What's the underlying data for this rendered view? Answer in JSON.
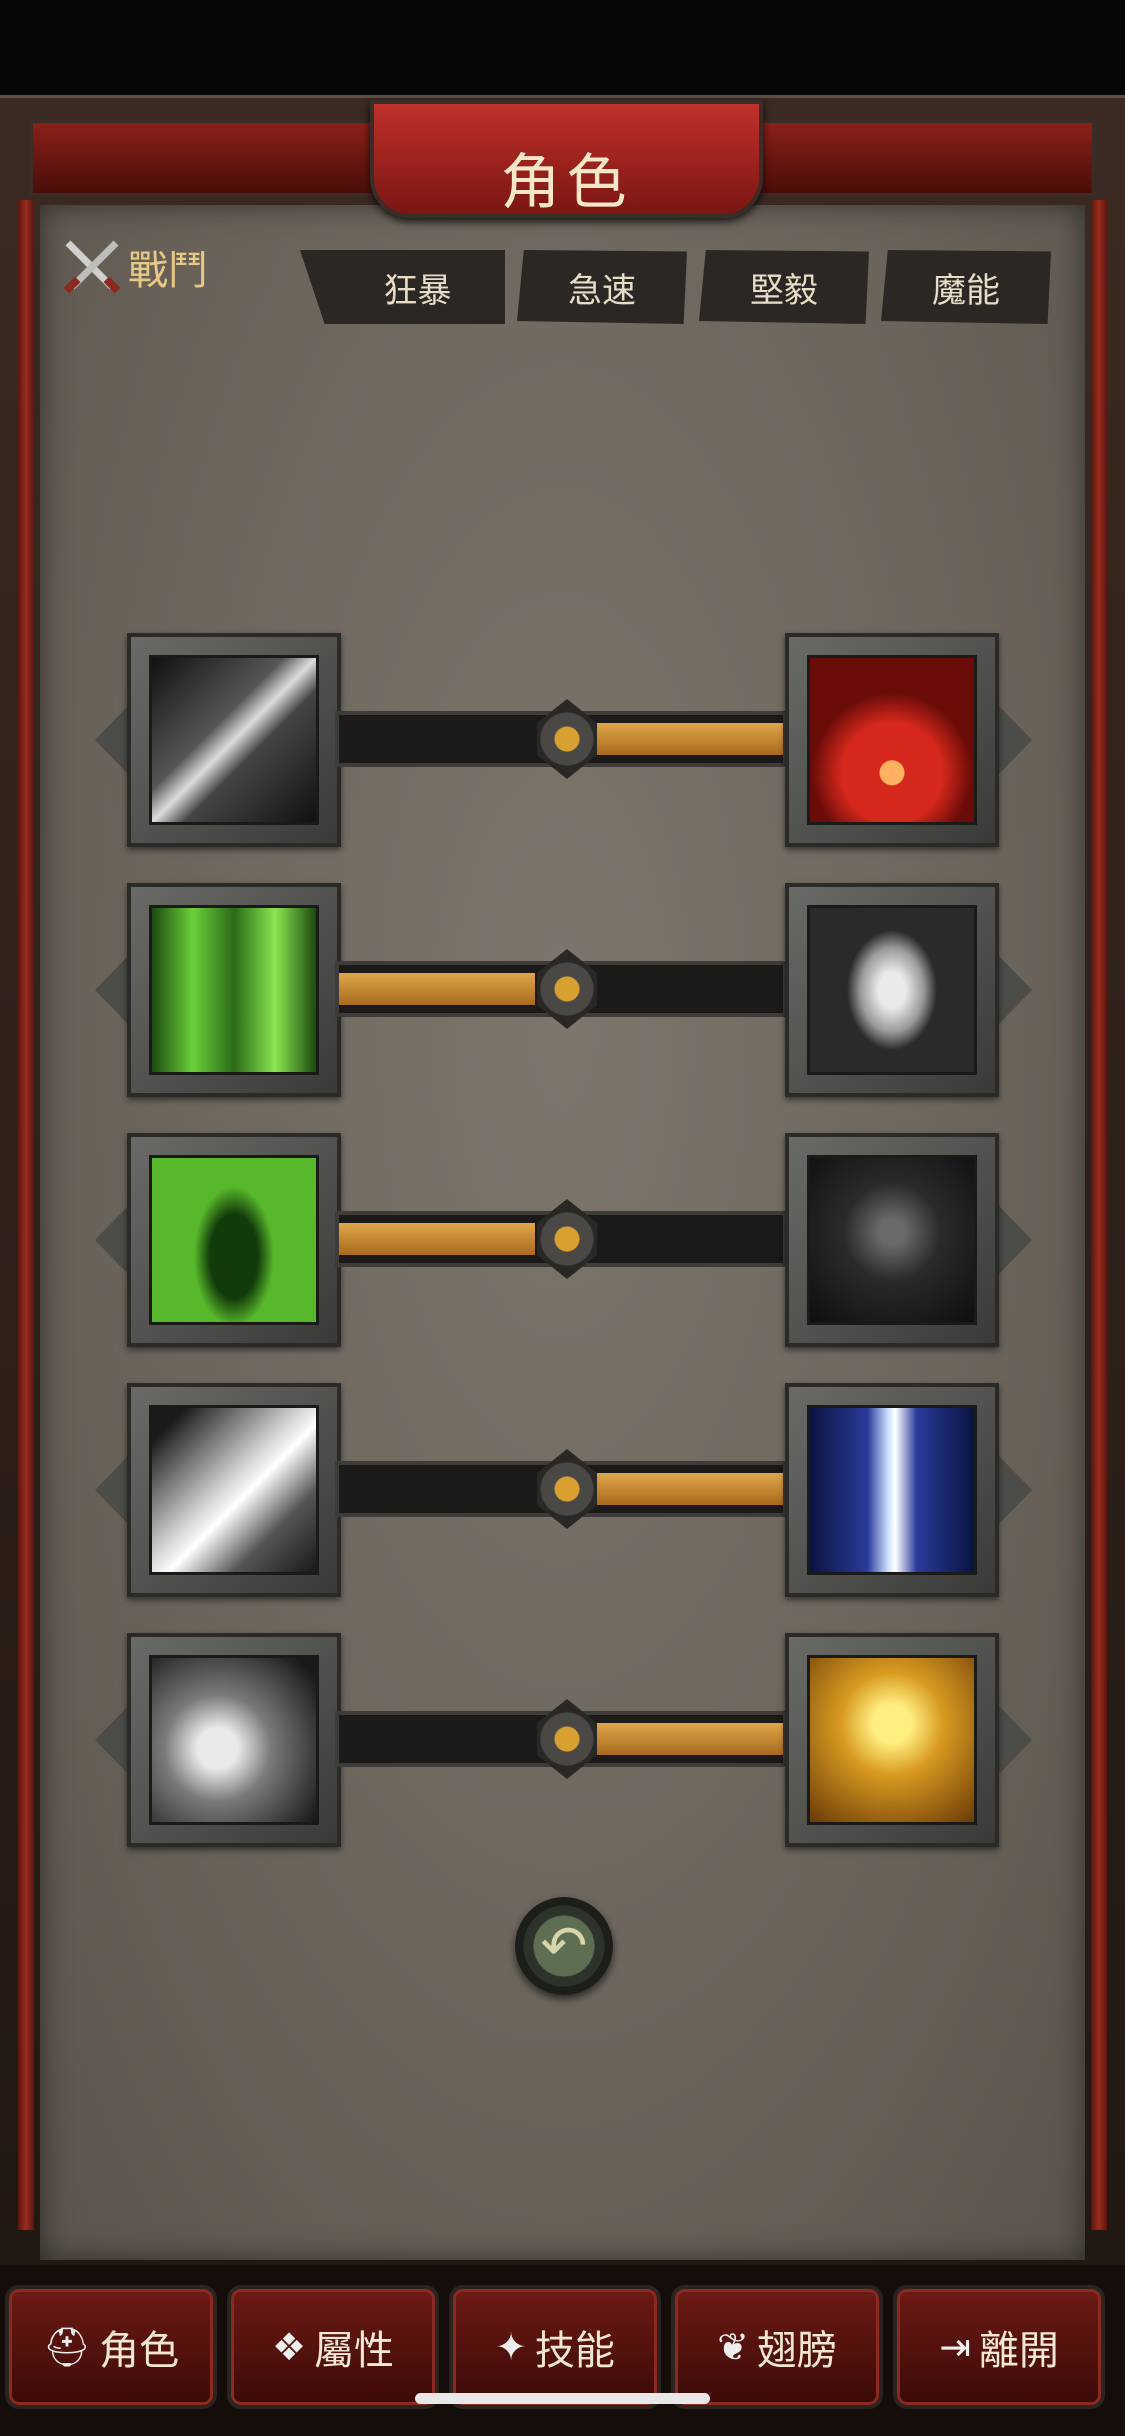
{
  "header": {
    "title": "角色"
  },
  "section": {
    "label": "戰鬥"
  },
  "tabs": [
    "狂暴",
    "急速",
    "堅毅",
    "魔能"
  ],
  "skill_pairs": [
    {
      "left_icon": "sword-skill-icon",
      "right_icon": "demon-rage-skill-icon",
      "balance": 0.5,
      "lean": "right"
    },
    {
      "left_icon": "healing-hand-skill-icon",
      "right_icon": "shield-egg-skill-icon",
      "balance": 0.5,
      "lean": "left"
    },
    {
      "left_icon": "regeneration-skill-icon",
      "right_icon": "dark-knight-skill-icon",
      "balance": 0.5,
      "lean": "left"
    },
    {
      "left_icon": "crystal-shard-skill-icon",
      "right_icon": "lightning-strike-skill-icon",
      "balance": 0.5,
      "lean": "right"
    },
    {
      "left_icon": "hammer-swing-skill-icon",
      "right_icon": "berserker-skill-icon",
      "balance": 0.5,
      "lean": "right"
    }
  ],
  "reset_icon": "undo-arrow-icon",
  "nav": [
    {
      "label": "角色",
      "icon": "helmet-icon"
    },
    {
      "label": "屬性",
      "icon": "attributes-icon"
    },
    {
      "label": "技能",
      "icon": "skills-icon"
    },
    {
      "label": "翅膀",
      "icon": "wings-icon"
    },
    {
      "label": "離開",
      "icon": "exit-icon"
    }
  ]
}
